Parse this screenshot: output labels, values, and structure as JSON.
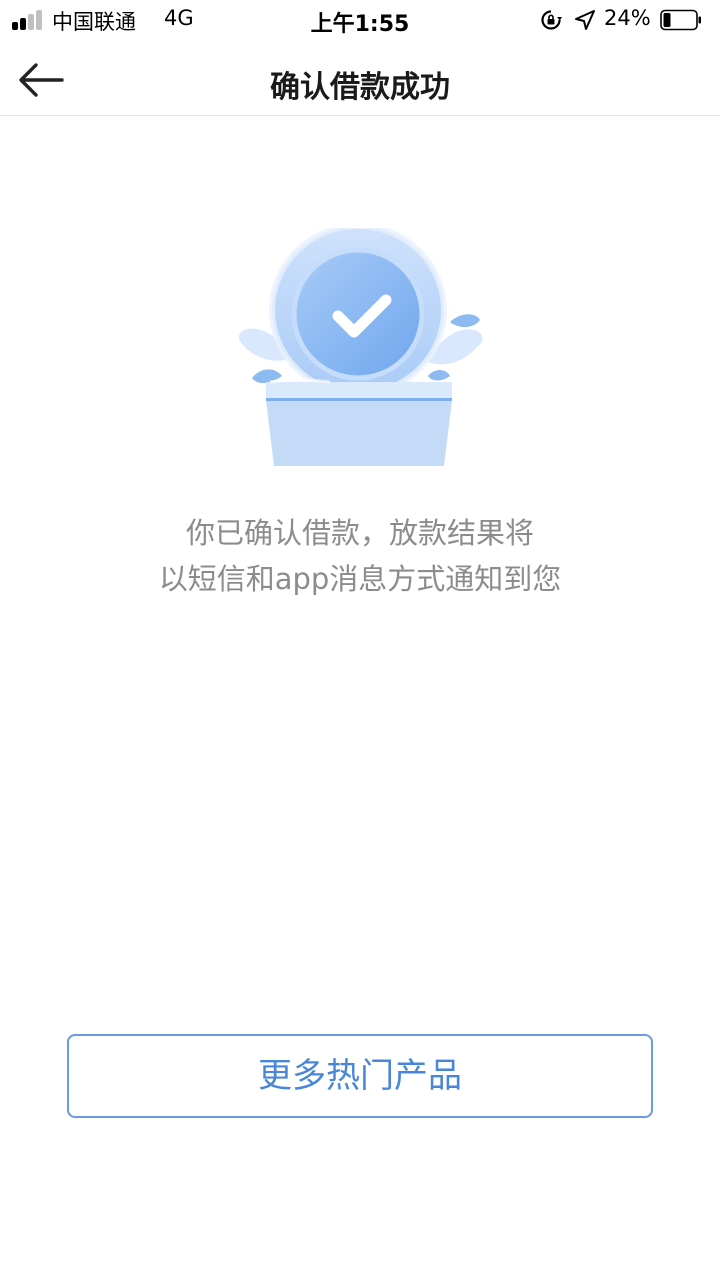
{
  "status_bar": {
    "carrier": "中国联通",
    "network": "4G",
    "time": "上午1:55",
    "battery_percent": "24%",
    "battery_level": 0.24,
    "signal_strength": 2,
    "signal_max": 4,
    "icons": [
      "signal-icon",
      "rotation-lock-icon",
      "location-arrow-icon",
      "battery-icon"
    ]
  },
  "nav": {
    "title": "确认借款成功",
    "back_icon": "back-arrow-icon"
  },
  "illustration": {
    "icon": "success-check-icon"
  },
  "message": {
    "line1": "你已确认借款，放款结果将",
    "line2": "以短信和app消息方式通知到您"
  },
  "actions": {
    "more_products_label": "更多热门产品"
  },
  "colors": {
    "accent": "#4a86d8",
    "button_border": "#6a9bde",
    "message_text": "#8c8c8c",
    "illustration_light": "#d6e6fb",
    "illustration_mid": "#9cc4f5"
  }
}
